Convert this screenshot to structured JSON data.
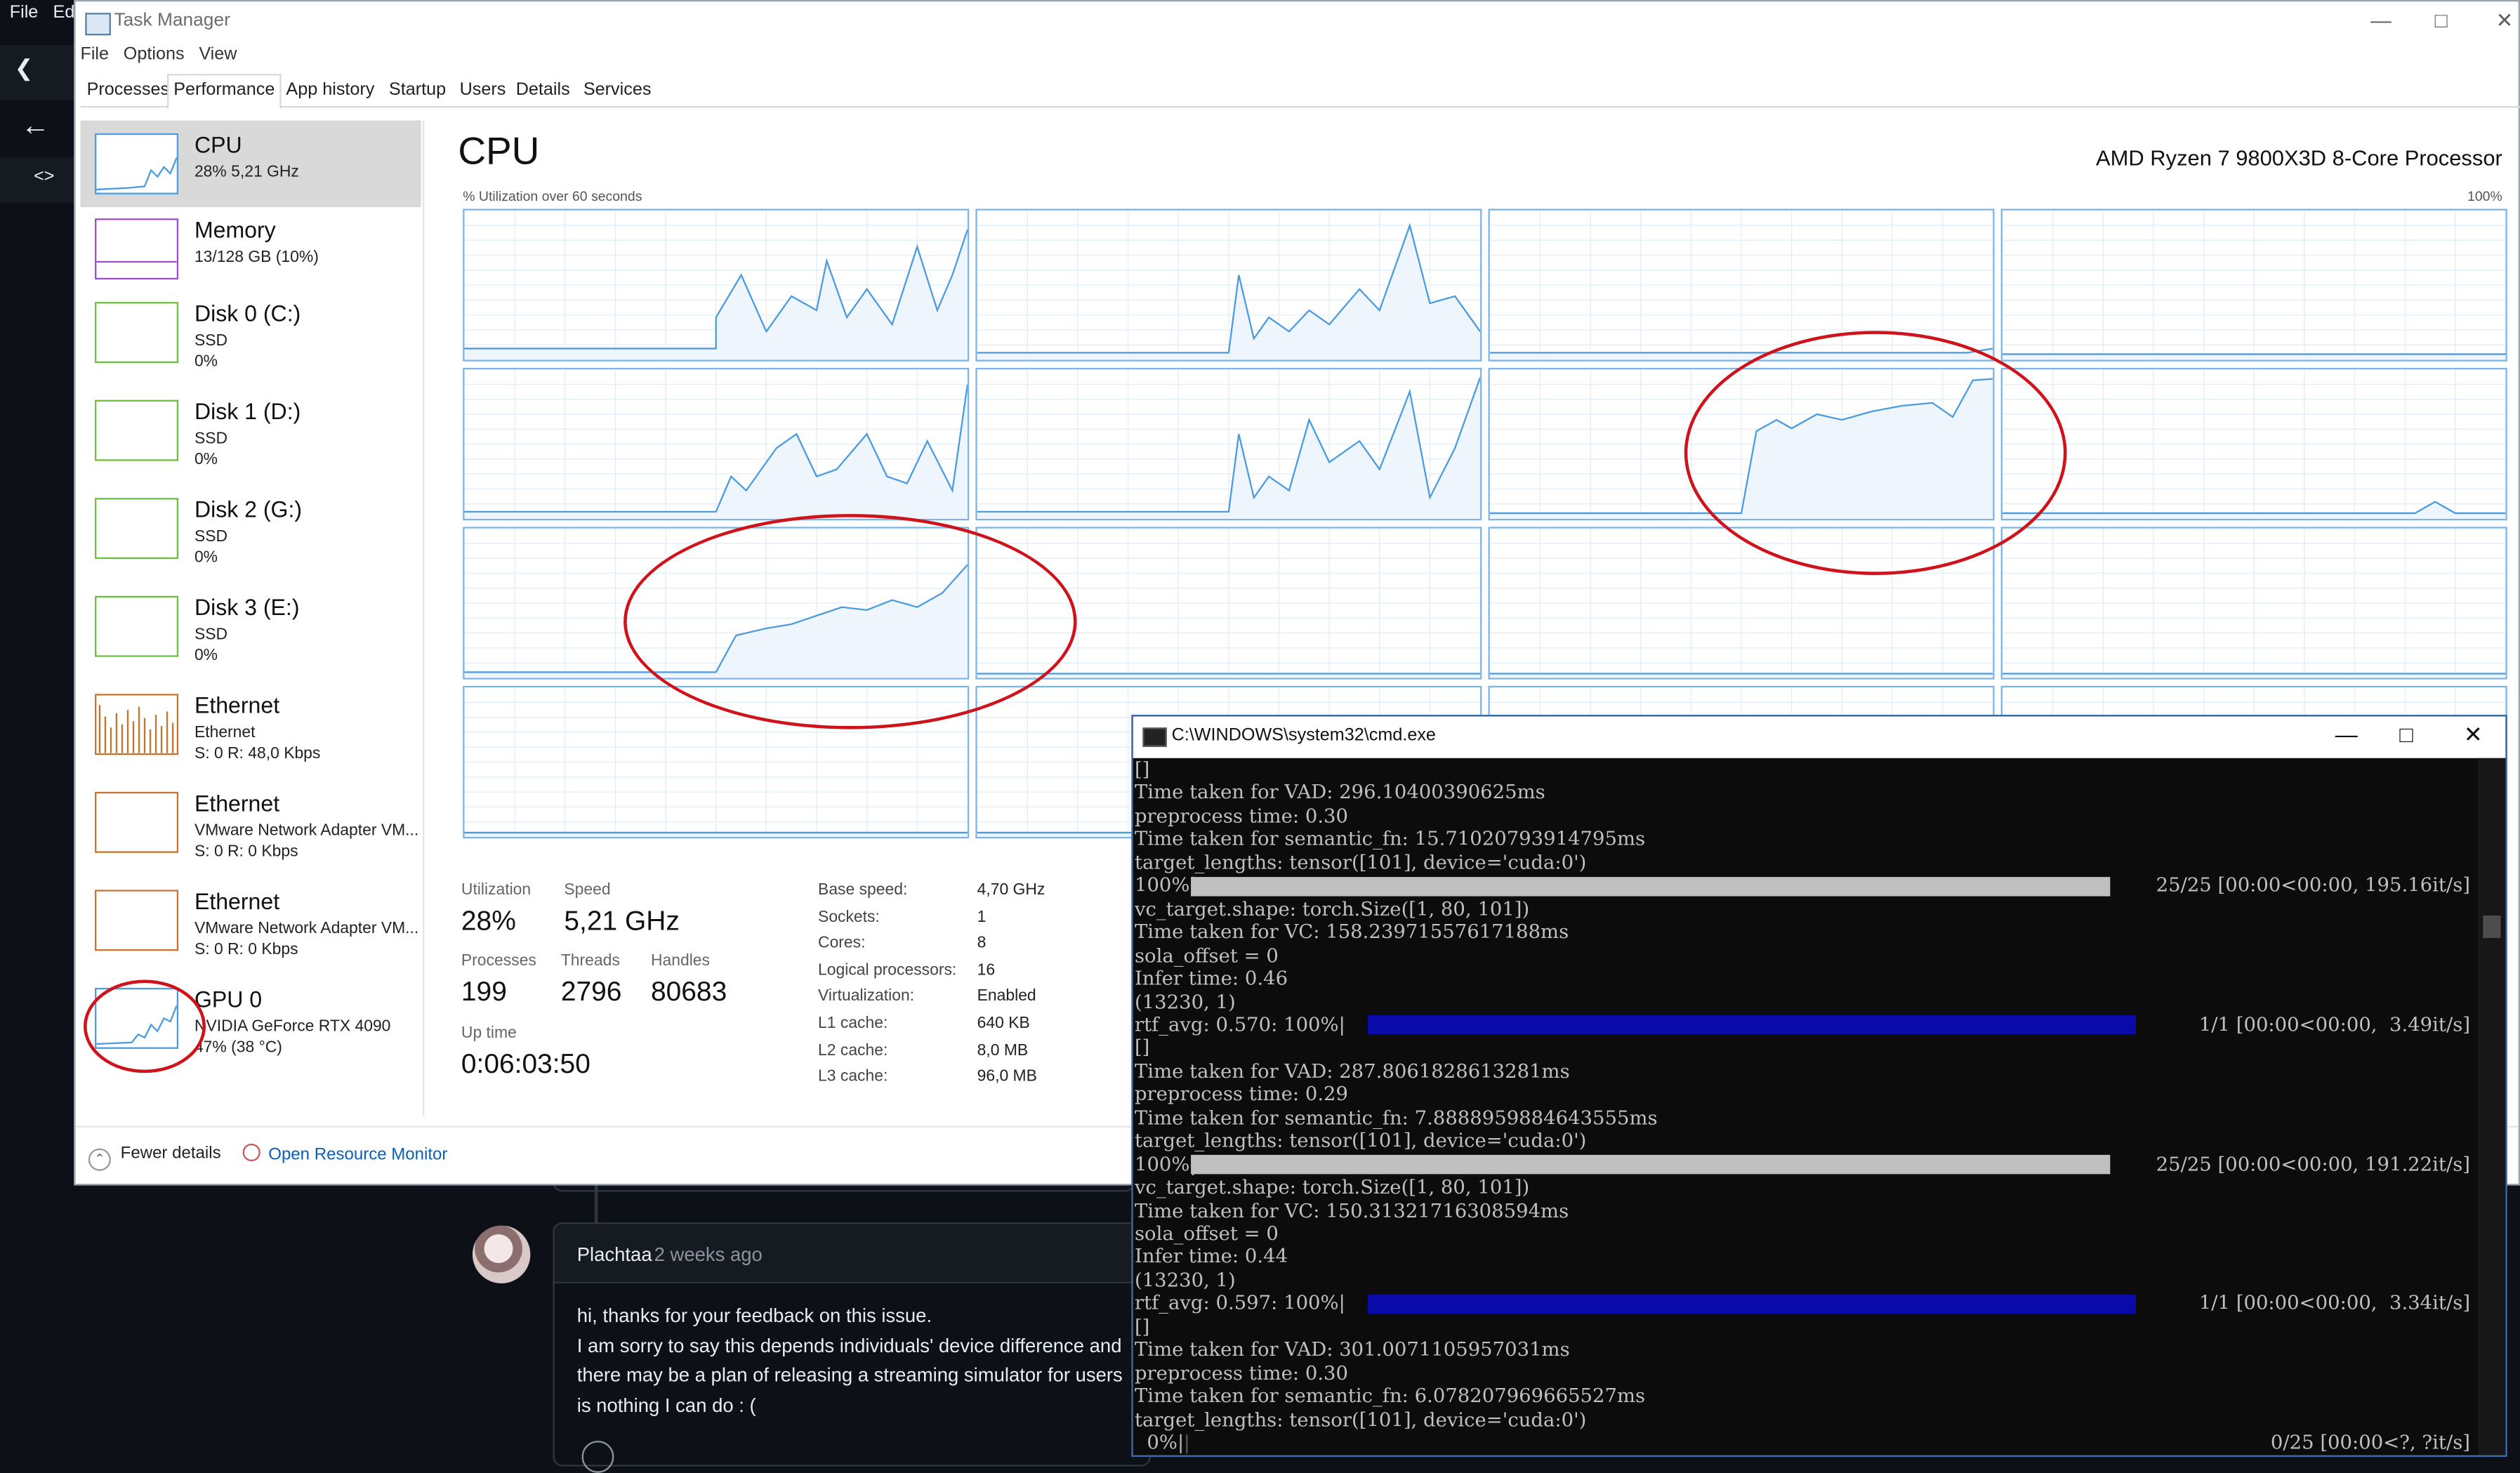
{
  "background_app": {
    "menu": [
      "File",
      "Edi"
    ],
    "github": {
      "author": "Plachtaa",
      "time_ago": "2 weeks ago",
      "comment_lines": [
        "hi, thanks for your feedback on this issue.",
        "I am sorry to say this depends individuals' device difference and",
        "there may be a plan of releasing a streaming simulator for users",
        "is nothing I can do : ("
      ]
    }
  },
  "task_manager": {
    "title": "Task Manager",
    "menu": [
      "File",
      "Options",
      "View"
    ],
    "tabs": [
      "Processes",
      "Performance",
      "App history",
      "Startup",
      "Users",
      "Details",
      "Services"
    ],
    "active_tab": "Performance",
    "sidebar": [
      {
        "name": "CPU",
        "sub1": "28% 5,21 GHz",
        "sub2": "",
        "color": "#4a9be0"
      },
      {
        "name": "Memory",
        "sub1": "13/128 GB (10%)",
        "sub2": "",
        "color": "#a24bd1"
      },
      {
        "name": "Disk 0 (C:)",
        "sub1": "SSD",
        "sub2": "0%",
        "color": "#6fbf3f"
      },
      {
        "name": "Disk 1 (D:)",
        "sub1": "SSD",
        "sub2": "0%",
        "color": "#6fbf3f"
      },
      {
        "name": "Disk 2 (G:)",
        "sub1": "SSD",
        "sub2": "0%",
        "color": "#6fbf3f"
      },
      {
        "name": "Disk 3 (E:)",
        "sub1": "SSD",
        "sub2": "0%",
        "color": "#6fbf3f"
      },
      {
        "name": "Ethernet",
        "sub1": "Ethernet",
        "sub2": "S: 0 R: 48,0 Kbps",
        "color": "#c9742c"
      },
      {
        "name": "Ethernet",
        "sub1": "VMware Network Adapter VM...",
        "sub2": "S: 0 R: 0 Kbps",
        "color": "#c9742c"
      },
      {
        "name": "Ethernet",
        "sub1": "VMware Network Adapter VM...",
        "sub2": "S: 0 R: 0 Kbps",
        "color": "#c9742c"
      },
      {
        "name": "GPU 0",
        "sub1": "NVIDIA GeForce RTX 4090",
        "sub2": "47% (38 °C)",
        "color": "#4a9be0"
      }
    ],
    "cpu": {
      "heading": "CPU",
      "processor": "AMD Ryzen 7 9800X3D 8-Core Processor",
      "graph_label": "% Utilization over 60 seconds",
      "graph_max": "100%",
      "stats": {
        "utilization_label": "Utilization",
        "utilization": "28%",
        "speed_label": "Speed",
        "speed": "5,21 GHz",
        "processes_label": "Processes",
        "processes": "199",
        "threads_label": "Threads",
        "threads": "2796",
        "handles_label": "Handles",
        "handles": "80683",
        "uptime_label": "Up time",
        "uptime": "0:06:03:50"
      },
      "details": [
        {
          "k": "Base speed:",
          "v": "4,70 GHz"
        },
        {
          "k": "Sockets:",
          "v": "1"
        },
        {
          "k": "Cores:",
          "v": "8"
        },
        {
          "k": "Logical processors:",
          "v": "16"
        },
        {
          "k": "Virtualization:",
          "v": "Enabled"
        },
        {
          "k": "L1 cache:",
          "v": "640 KB"
        },
        {
          "k": "L2 cache:",
          "v": "8,0 MB"
        },
        {
          "k": "L3 cache:",
          "v": "96,0 MB"
        }
      ]
    },
    "footer": {
      "fewer": "Fewer details",
      "resource_monitor": "Open Resource Monitor"
    }
  },
  "cmd": {
    "title": "C:\\WINDOWS\\system32\\cmd.exe",
    "lines": [
      {
        "text": "[]"
      },
      {
        "text": "Time taken for VAD: 296.10400390625ms"
      },
      {
        "text": "preprocess time: 0.30"
      },
      {
        "text": "Time taken for semantic_fn: 15.71020793914795ms"
      },
      {
        "text": "target_lengths: tensor([101], device='cuda:0')"
      },
      {
        "text": "100%|",
        "bar": "gray",
        "right": "25/25 [00:00<00:00, 195.16it/s]"
      },
      {
        "text": "vc_target.shape: torch.Size([1, 80, 101])"
      },
      {
        "text": "Time taken for VC: 158.23971557617188ms"
      },
      {
        "text": "sola_offset = 0"
      },
      {
        "text": "Infer time: 0.46"
      },
      {
        "text": "(13230, 1)"
      },
      {
        "text": "rtf_avg: 0.570: 100%|",
        "bar": "blue",
        "right": "1/1 [00:00<00:00,  3.49it/s]"
      },
      {
        "text": "[]"
      },
      {
        "text": "Time taken for VAD: 287.8061828613281ms"
      },
      {
        "text": "preprocess time: 0.29"
      },
      {
        "text": "Time taken for semantic_fn: 7.8888959884643555ms"
      },
      {
        "text": "target_lengths: tensor([101], device='cuda:0')"
      },
      {
        "text": "100%|",
        "bar": "gray",
        "right": "25/25 [00:00<00:00, 191.22it/s]"
      },
      {
        "text": "vc_target.shape: torch.Size([1, 80, 101])"
      },
      {
        "text": "Time taken for VC: 150.31321716308594ms"
      },
      {
        "text": "sola_offset = 0"
      },
      {
        "text": "Infer time: 0.44"
      },
      {
        "text": "(13230, 1)"
      },
      {
        "text": "rtf_avg: 0.597: 100%|",
        "bar": "blue",
        "right": "1/1 [00:00<00:00,  3.34it/s]"
      },
      {
        "text": "[]"
      },
      {
        "text": "Time taken for VAD: 301.0071105957031ms"
      },
      {
        "text": "preprocess time: 0.30"
      },
      {
        "text": "Time taken for semantic_fn: 6.078207969665527ms"
      },
      {
        "text": "target_lengths: tensor([101], device='cuda:0')"
      },
      {
        "text": "  0%|",
        "bar": "none",
        "right": "0/25 [00:00<?, ?it/s]"
      }
    ]
  },
  "colors": {
    "cpu_graph": "#4a9be0",
    "annotation": "#d0131b",
    "cmd_blue_bar": "#0a0aa8",
    "cmd_gray_bar": "#c0c0c0"
  }
}
